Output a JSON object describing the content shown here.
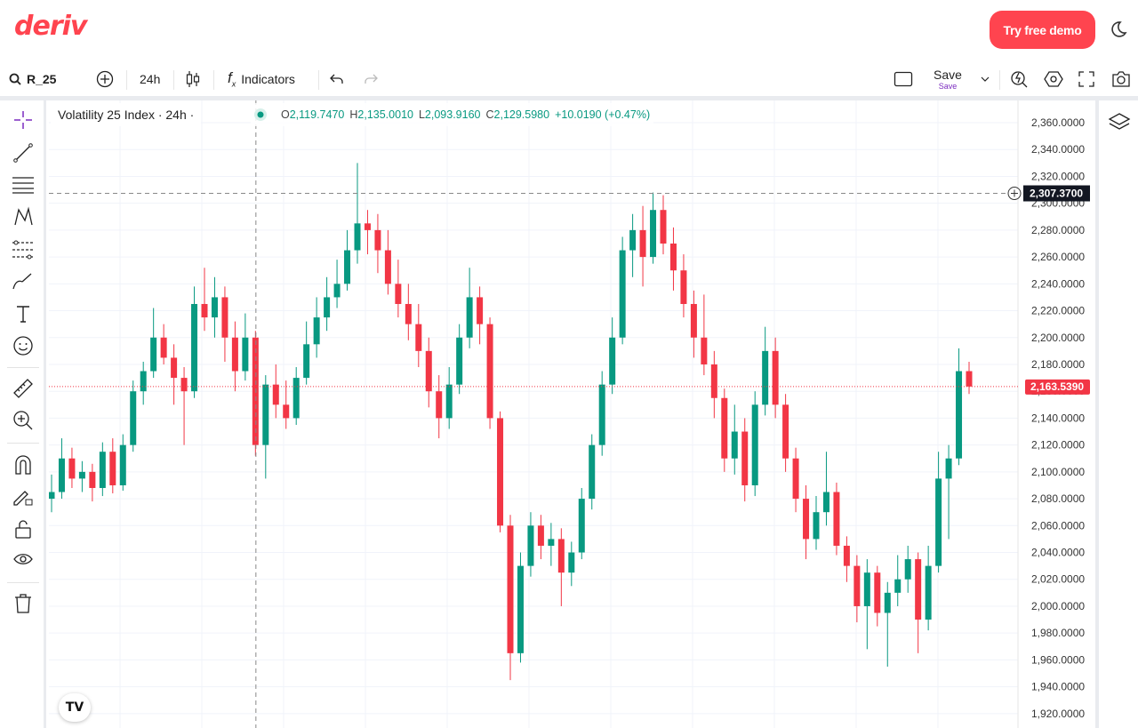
{
  "header": {
    "logo": "deriv",
    "demo_button": "Try free demo",
    "theme_icon": "moon-icon"
  },
  "toolbar": {
    "symbol": "R_25",
    "interval": "24h",
    "indicators": "Indicators",
    "save": "Save",
    "save_sub": "Save"
  },
  "legend": {
    "title": "Volatility 25 Index · 24h ·",
    "o_label": "O",
    "o": "2,119.7470",
    "h_label": "H",
    "h": "2,135.0010",
    "l_label": "L",
    "l": "2,093.9160",
    "c_label": "C",
    "c": "2,129.5980",
    "change": "+10.0190 (+0.47%)"
  },
  "colors": {
    "brand": "#ff444f",
    "up": "#089981",
    "down": "#f23645",
    "accent": "#7b2cbf"
  },
  "chart_data": {
    "type": "candlestick",
    "ylim": [
      1910,
      2370
    ],
    "y_ticks": [
      "2,360.0000",
      "2,340.0000",
      "2,320.0000",
      "2,300.0000",
      "2,280.0000",
      "2,260.0000",
      "2,240.0000",
      "2,220.0000",
      "2,200.0000",
      "2,180.0000",
      "2,160.0000",
      "2,140.0000",
      "2,120.0000",
      "2,100.0000",
      "2,080.0000",
      "2,060.0000",
      "2,040.0000",
      "2,020.0000",
      "2,000.0000",
      "1,980.0000",
      "1,960.0000",
      "1,940.0000",
      "1,920.0000"
    ],
    "y_tick_values": [
      2360,
      2340,
      2320,
      2300,
      2280,
      2260,
      2240,
      2220,
      2200,
      2180,
      2160,
      2140,
      2120,
      2100,
      2080,
      2060,
      2040,
      2020,
      2000,
      1980,
      1960,
      1940,
      1920
    ],
    "crosshair_price": "2,307.3700",
    "crosshair_value": 2307.37,
    "crosshair_candle": 20,
    "last_price": "2,163.5390",
    "last_value": 2163.539,
    "grid": true,
    "candles": [
      [
        2080,
        2098,
        2070,
        2085
      ],
      [
        2085,
        2125,
        2080,
        2110
      ],
      [
        2110,
        2118,
        2088,
        2095
      ],
      [
        2095,
        2108,
        2085,
        2100
      ],
      [
        2100,
        2106,
        2078,
        2088
      ],
      [
        2088,
        2122,
        2082,
        2115
      ],
      [
        2115,
        2125,
        2084,
        2090
      ],
      [
        2090,
        2128,
        2086,
        2120
      ],
      [
        2120,
        2168,
        2115,
        2160
      ],
      [
        2160,
        2182,
        2150,
        2175
      ],
      [
        2175,
        2222,
        2170,
        2200
      ],
      [
        2200,
        2210,
        2180,
        2185
      ],
      [
        2185,
        2195,
        2150,
        2170
      ],
      [
        2170,
        2178,
        2120,
        2160
      ],
      [
        2160,
        2238,
        2155,
        2225
      ],
      [
        2225,
        2252,
        2205,
        2215
      ],
      [
        2215,
        2245,
        2200,
        2230
      ],
      [
        2230,
        2238,
        2182,
        2200
      ],
      [
        2200,
        2212,
        2160,
        2175
      ],
      [
        2175,
        2218,
        2168,
        2200
      ],
      [
        2200,
        2205,
        2112,
        2120
      ],
      [
        2120,
        2172,
        2095,
        2165
      ],
      [
        2165,
        2180,
        2140,
        2150
      ],
      [
        2150,
        2168,
        2132,
        2140
      ],
      [
        2140,
        2178,
        2135,
        2170
      ],
      [
        2170,
        2212,
        2165,
        2195
      ],
      [
        2195,
        2230,
        2185,
        2215
      ],
      [
        2215,
        2245,
        2205,
        2230
      ],
      [
        2230,
        2258,
        2222,
        2240
      ],
      [
        2240,
        2280,
        2235,
        2265
      ],
      [
        2265,
        2330,
        2255,
        2285
      ],
      [
        2285,
        2295,
        2262,
        2280
      ],
      [
        2280,
        2292,
        2248,
        2265
      ],
      [
        2265,
        2280,
        2232,
        2240
      ],
      [
        2240,
        2258,
        2215,
        2225
      ],
      [
        2225,
        2240,
        2198,
        2210
      ],
      [
        2210,
        2225,
        2178,
        2190
      ],
      [
        2190,
        2200,
        2148,
        2160
      ],
      [
        2160,
        2172,
        2125,
        2140
      ],
      [
        2140,
        2178,
        2132,
        2165
      ],
      [
        2165,
        2210,
        2158,
        2200
      ],
      [
        2200,
        2252,
        2192,
        2230
      ],
      [
        2230,
        2238,
        2195,
        2210
      ],
      [
        2210,
        2215,
        2132,
        2140
      ],
      [
        2140,
        2145,
        2055,
        2060
      ],
      [
        2060,
        2068,
        1945,
        1965
      ],
      [
        1965,
        2040,
        1958,
        2030
      ],
      [
        2030,
        2070,
        2022,
        2060
      ],
      [
        2060,
        2068,
        2035,
        2045
      ],
      [
        2045,
        2062,
        2030,
        2050
      ],
      [
        2050,
        2058,
        2000,
        2025
      ],
      [
        2025,
        2048,
        2015,
        2040
      ],
      [
        2040,
        2088,
        2035,
        2080
      ],
      [
        2080,
        2128,
        2072,
        2120
      ],
      [
        2120,
        2175,
        2112,
        2165
      ],
      [
        2165,
        2215,
        2158,
        2200
      ],
      [
        2200,
        2275,
        2195,
        2265
      ],
      [
        2265,
        2292,
        2245,
        2280
      ],
      [
        2280,
        2298,
        2238,
        2260
      ],
      [
        2260,
        2308,
        2255,
        2295
      ],
      [
        2295,
        2306,
        2262,
        2270
      ],
      [
        2270,
        2282,
        2235,
        2250
      ],
      [
        2250,
        2262,
        2215,
        2225
      ],
      [
        2225,
        2235,
        2185,
        2200
      ],
      [
        2200,
        2232,
        2172,
        2180
      ],
      [
        2180,
        2190,
        2140,
        2155
      ],
      [
        2155,
        2162,
        2100,
        2110
      ],
      [
        2110,
        2150,
        2098,
        2130
      ],
      [
        2130,
        2140,
        2078,
        2090
      ],
      [
        2090,
        2160,
        2082,
        2150
      ],
      [
        2150,
        2208,
        2142,
        2190
      ],
      [
        2190,
        2200,
        2140,
        2150
      ],
      [
        2150,
        2158,
        2100,
        2110
      ],
      [
        2110,
        2118,
        2070,
        2080
      ],
      [
        2080,
        2090,
        2035,
        2050
      ],
      [
        2050,
        2082,
        2042,
        2070
      ],
      [
        2070,
        2115,
        2060,
        2085
      ],
      [
        2085,
        2092,
        2038,
        2045
      ],
      [
        2045,
        2052,
        2018,
        2030
      ],
      [
        2030,
        2038,
        1988,
        2000
      ],
      [
        2000,
        2035,
        1968,
        2025
      ],
      [
        2025,
        2030,
        1985,
        1995
      ],
      [
        1995,
        2018,
        1955,
        2010
      ],
      [
        2010,
        2038,
        2000,
        2020
      ],
      [
        2020,
        2045,
        2010,
        2035
      ],
      [
        2035,
        2040,
        1965,
        1990
      ],
      [
        1990,
        2045,
        1982,
        2030
      ],
      [
        2030,
        2115,
        2025,
        2095
      ],
      [
        2095,
        2120,
        2050,
        2110
      ],
      [
        2110,
        2192,
        2105,
        2175
      ],
      [
        2175,
        2182,
        2158,
        2163.539
      ]
    ]
  }
}
